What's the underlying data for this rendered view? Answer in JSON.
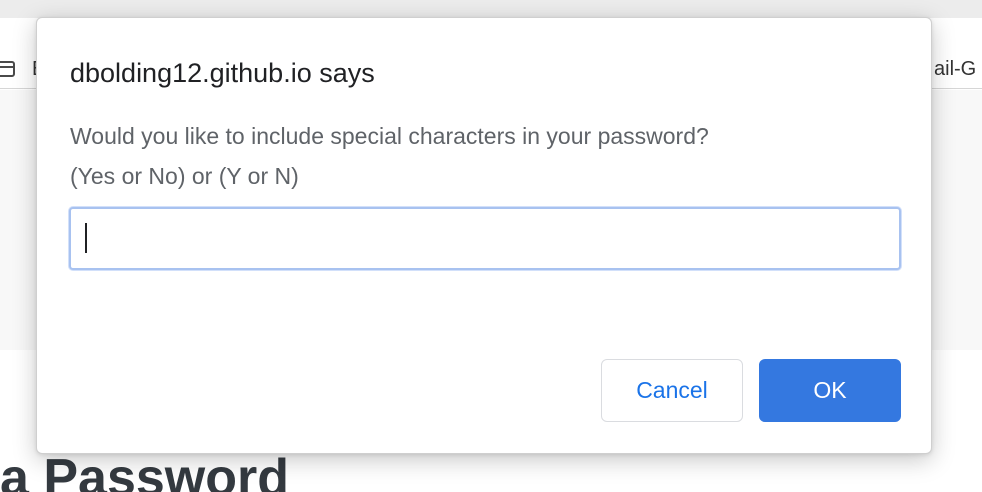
{
  "browser": {
    "bookmarks": {
      "left_label": "B",
      "right_label": "ail-G"
    }
  },
  "page": {
    "heading": "a Password"
  },
  "dialog": {
    "title": "dbolding12.github.io says",
    "message_line1": "Would you like to include special characters in your password?",
    "message_line2": "(Yes or No) or (Y or N)",
    "input_value": "",
    "cancel_label": "Cancel",
    "ok_label": "OK"
  },
  "colors": {
    "accent": "#3478e0",
    "cancel_text": "#1a73e8",
    "input_focus": "#a8c2f0"
  }
}
